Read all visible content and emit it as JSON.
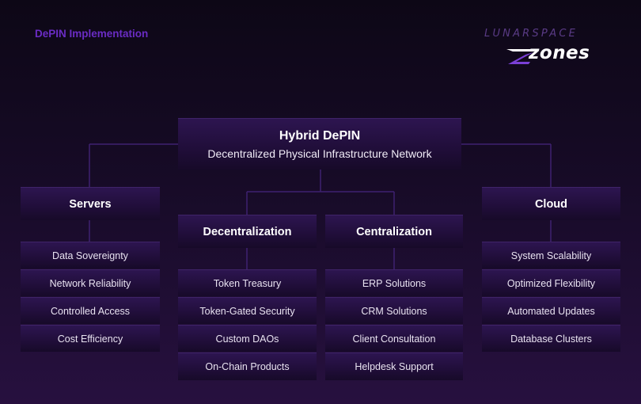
{
  "header": {
    "tag": "DePIN Implementation"
  },
  "brand": {
    "top": "Lunarspace",
    "zones": "zones"
  },
  "root": {
    "title": "Hybrid DePIN",
    "subtitle": "Decentralized Physical Infrastructure Network"
  },
  "columns": [
    {
      "title": "Servers",
      "items": [
        "Data Sovereignty",
        "Network Reliability",
        "Controlled Access",
        "Cost Efficiency"
      ]
    },
    {
      "title": "Decentralization",
      "items": [
        "Token Treasury",
        "Token-Gated Security",
        "Custom DAOs",
        "On-Chain Products"
      ]
    },
    {
      "title": "Centralization",
      "items": [
        "ERP Solutions",
        "CRM Solutions",
        "Client Consultation",
        "Helpdesk Support"
      ]
    },
    {
      "title": "Cloud",
      "items": [
        "System Scalability",
        "Optimized Flexibility",
        "Automated Updates",
        "Database Clusters"
      ]
    }
  ],
  "colors": {
    "line": "#3e2170",
    "accent": "#6a2cc4",
    "box_top": "#2d1550",
    "box_bottom": "#170a29"
  }
}
